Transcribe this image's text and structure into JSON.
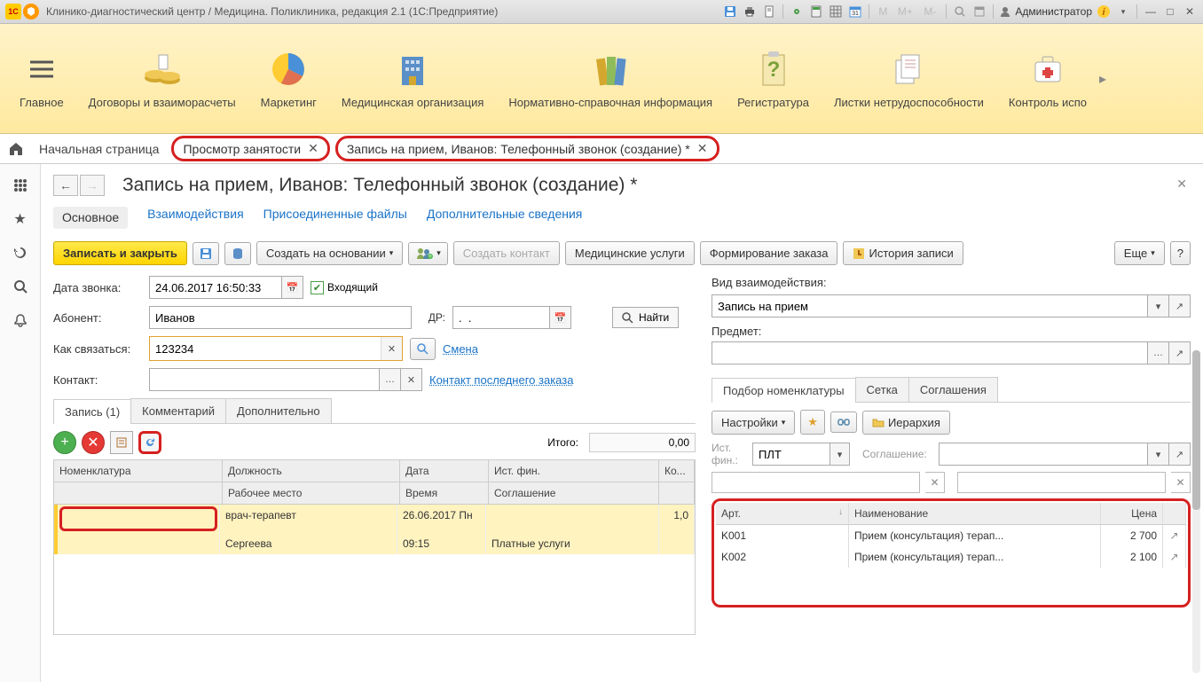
{
  "titlebar": {
    "title": "Клинико-диагностический центр / Медицина. Поликлиника, редакция 2.1  (1С:Предприятие)",
    "user": "Администратор",
    "m_label": "M",
    "mplus_label": "M+",
    "mminus_label": "M-"
  },
  "ribbon": {
    "items": [
      {
        "label": "Главное"
      },
      {
        "label": "Договоры и взаиморасчеты"
      },
      {
        "label": "Маркетинг"
      },
      {
        "label": "Медицинская организация"
      },
      {
        "label": "Нормативно-справочная информация"
      },
      {
        "label": "Регистратура"
      },
      {
        "label": "Листки нетрудоспособности"
      },
      {
        "label": "Контроль испо"
      }
    ]
  },
  "tabrow": {
    "home": "Начальная страница",
    "pill1": "Просмотр занятости",
    "pill2": "Запись на прием, Иванов: Телефонный звонок (создание) *"
  },
  "page": {
    "title": "Запись на прием, Иванов: Телефонный звонок (создание) *"
  },
  "subnav": {
    "main": "Основное",
    "inter": "Взаимодействия",
    "files": "Присоединенные файлы",
    "extra": "Дополнительные сведения"
  },
  "toolbar": {
    "save_close": "Записать и закрыть",
    "create_based": "Создать на основании",
    "create_contact": "Создать контакт",
    "med_services": "Медицинские услуги",
    "form_order": "Формирование заказа",
    "history": "История записи",
    "more": "Еще",
    "help": "?"
  },
  "form": {
    "date_label": "Дата звонка:",
    "date_value": "24.06.2017 16:50:33",
    "incoming_label": "Входящий",
    "abonent_label": "Абонент:",
    "abonent_value": "Иванов",
    "dr_label": "ДР:",
    "dr_value": ".  .",
    "find_label": "Найти",
    "howcontact_label": "Как связаться:",
    "howcontact_value": "123234",
    "shift_link": "Смена",
    "contact_label": "Контакт:",
    "lastorder_link": "Контакт последнего заказа",
    "kind_label": "Вид взаимодействия:",
    "kind_value": "Запись на прием",
    "subject_label": "Предмет:"
  },
  "record_tabs": {
    "t1": "Запись (1)",
    "t2": "Комментарий",
    "t3": "Дополнительно"
  },
  "itogo": {
    "label": "Итого:",
    "value": "0,00"
  },
  "rec_table": {
    "h_nomen": "Номенклатура",
    "h_post": "Должность",
    "h_date": "Дата",
    "h_fin": "Ист. фин.",
    "h_qty": "Ко...",
    "h_workplace": "Рабочее место",
    "h_time": "Время",
    "h_agr": "Соглашение",
    "r_post": "врач-терапевт",
    "r_date": "26.06.2017 Пн",
    "r_fin": "",
    "r_qty": "1,0",
    "r_workplace": "Сергеева",
    "r_time": "09:15",
    "r_agr": "Платные услуги"
  },
  "rpanel": {
    "tab1": "Подбор номенклатуры",
    "tab2": "Сетка",
    "tab3": "Соглашения",
    "settings": "Настройки",
    "hierarchy": "Иерархия",
    "source_label": "Ист. фин.:",
    "source_value": "ПЛТ",
    "agreement_label": "Соглашение:"
  },
  "nom_table": {
    "h_art": "Арт.",
    "h_name": "Наименование",
    "h_price": "Цена",
    "rows": [
      {
        "art": "K001",
        "name": "Прием (консультация) терап...",
        "price": "2 700"
      },
      {
        "art": "K002",
        "name": "Прием (консультация) терап...",
        "price": "2 100"
      }
    ]
  }
}
